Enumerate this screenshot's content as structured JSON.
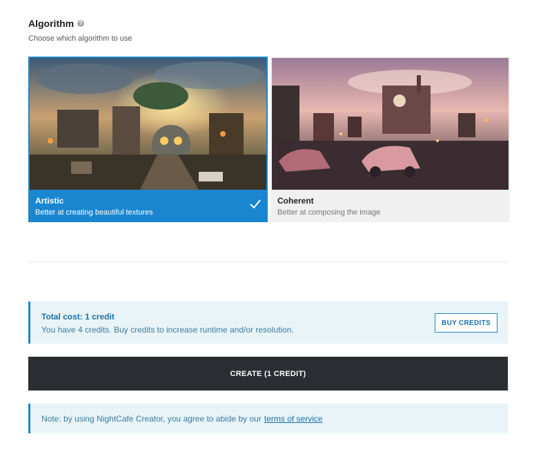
{
  "algorithm": {
    "title": "Algorithm",
    "help_icon": "?",
    "subtitle": "Choose which algorithm to use",
    "options": [
      {
        "label": "Artistic",
        "description": "Better at creating beautiful textures",
        "selected": true
      },
      {
        "label": "Coherent",
        "description": "Better at composing the image",
        "selected": false
      }
    ],
    "accent_color": "#1a86d0"
  },
  "cost": {
    "title": "Total cost: 1 credit",
    "text": "You have 4 credits. Buy credits to increase runtime and/or resolution.",
    "buy_label": "BUY CREDITS"
  },
  "create": {
    "label": "CREATE (1 CREDIT)",
    "color": "#2a2d31"
  },
  "note": {
    "text": "Note: by using NightCafe Creator, you agree to abide by our",
    "link": "terms of service"
  }
}
